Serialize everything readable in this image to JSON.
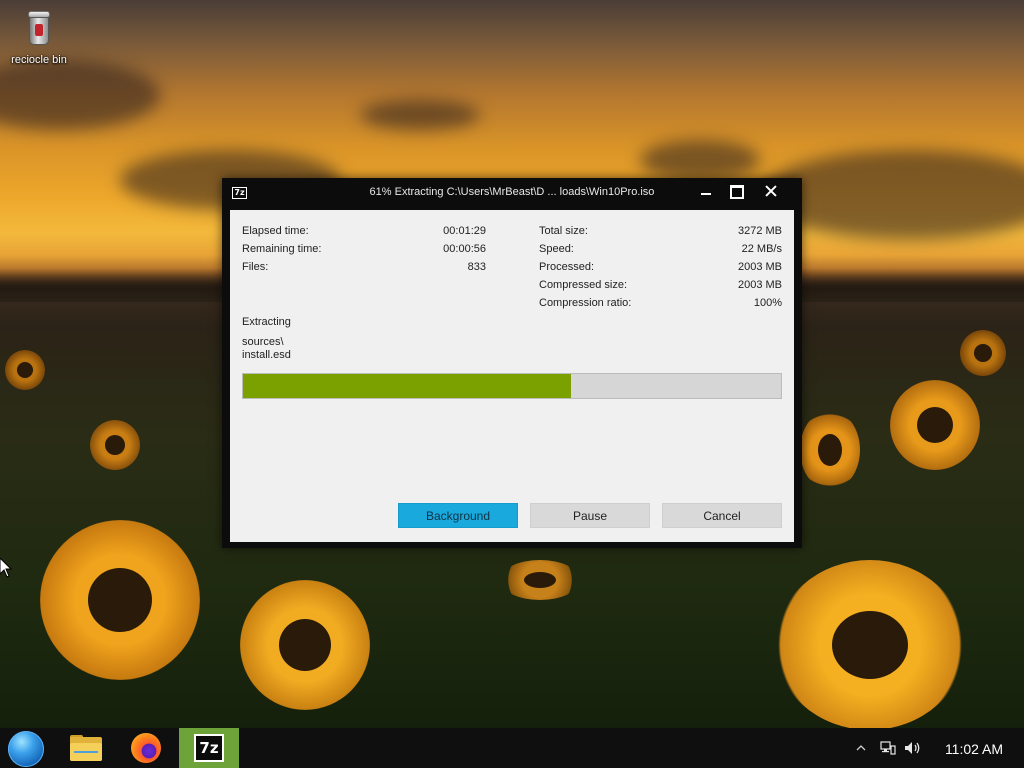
{
  "desktop": {
    "icons": [
      {
        "label": "reciocle bin",
        "icon": "recycle-bin-icon"
      }
    ]
  },
  "window": {
    "app_icon_text": "7z",
    "title": "61% Extracting C:\\Users\\MrBeast\\D ... loads\\Win10Pro.iso",
    "controls": [
      "minimize",
      "maximize",
      "close"
    ]
  },
  "stats_left": [
    {
      "label": "Elapsed time:",
      "value": "00:01:29"
    },
    {
      "label": "Remaining time:",
      "value": "00:00:56"
    },
    {
      "label": "Files:",
      "value": "833"
    }
  ],
  "stats_right": [
    {
      "label": "Total size:",
      "value": "3272 MB"
    },
    {
      "label": "Speed:",
      "value": "22 MB/s"
    },
    {
      "label": "Processed:",
      "value": "2003 MB"
    },
    {
      "label": "Compressed size:",
      "value": "2003 MB"
    },
    {
      "label": "Compression ratio:",
      "value": "100%"
    }
  ],
  "operation": {
    "status": "Extracting",
    "path_line1": "sources\\",
    "path_line2": "install.esd"
  },
  "progress": {
    "percent": 61,
    "color": "#7aa100"
  },
  "buttons": {
    "background": "Background",
    "pause": "Pause",
    "cancel": "Cancel"
  },
  "colors": {
    "accent_button": "#1aa9dd",
    "taskbar": "#0f0f0f",
    "active_app": "#6ea33a"
  },
  "taskbar": {
    "apps": [
      {
        "name": "start",
        "icon": "start-orb-icon"
      },
      {
        "name": "file-explorer",
        "icon": "folder-icon"
      },
      {
        "name": "firefox",
        "icon": "firefox-icon"
      },
      {
        "name": "7-zip",
        "icon": "7zip-icon",
        "label": "7z",
        "active": true
      }
    ],
    "tray_icons": [
      "chevron-up-icon",
      "network-icon",
      "volume-icon"
    ],
    "clock": "11:02 AM"
  }
}
